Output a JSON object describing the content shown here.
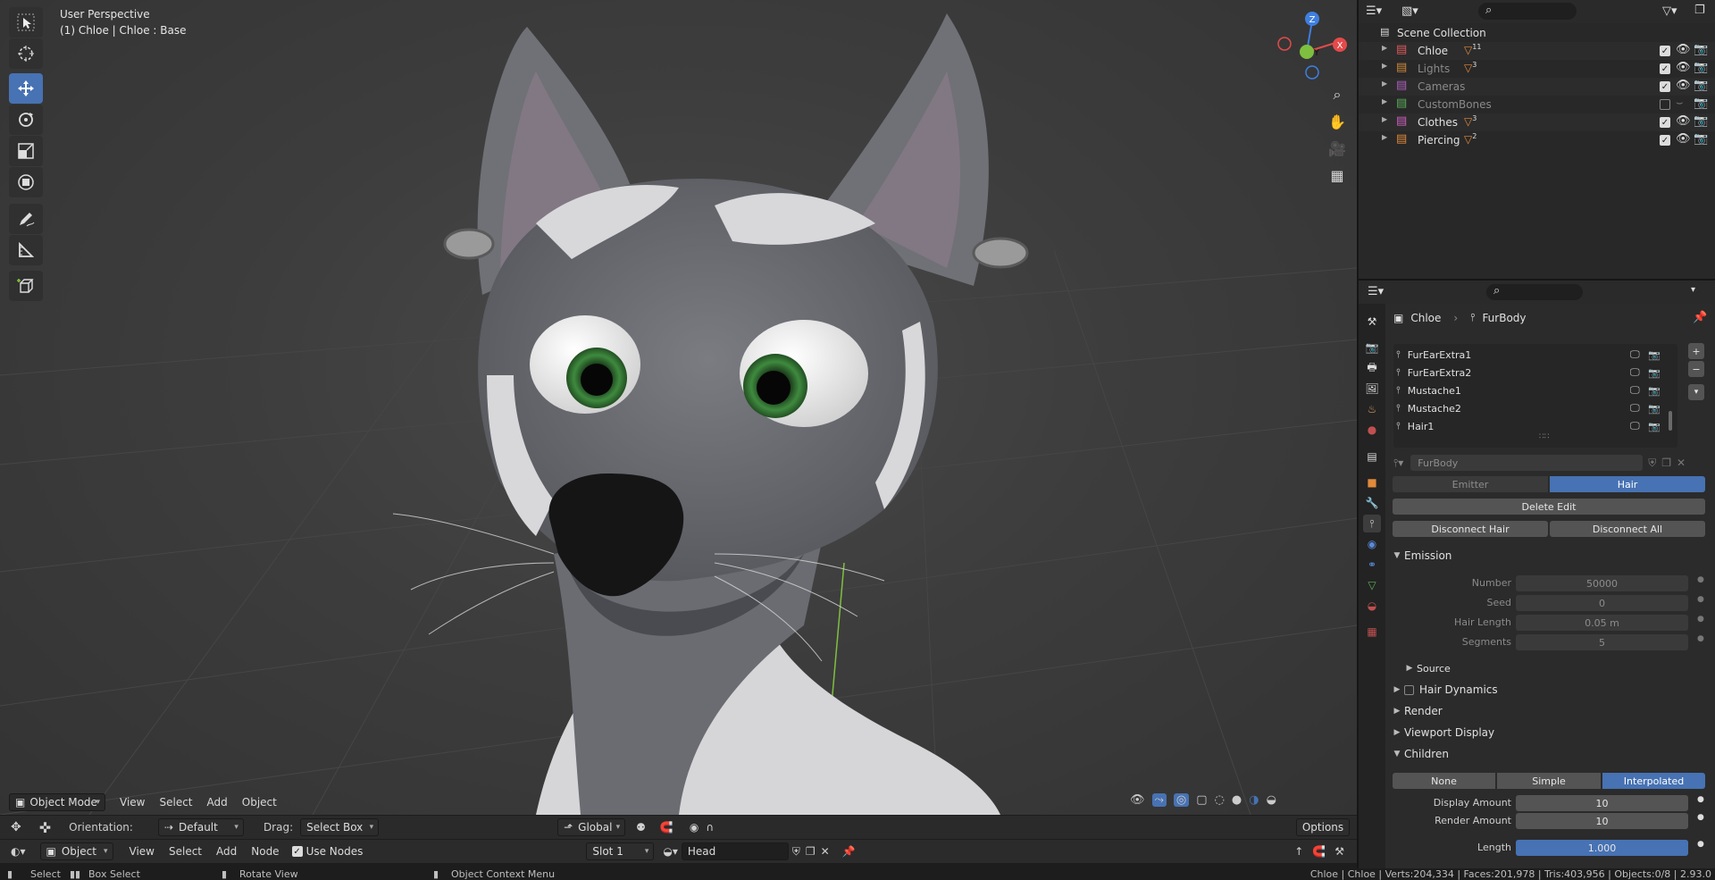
{
  "viewport": {
    "perspective_label": "User Perspective",
    "object_label": "(1) Chloe | Chloe : Base",
    "gizmo": {
      "z": "Z",
      "y": "Y",
      "x": "X"
    },
    "header": {
      "mode": "Object Mode",
      "menu": [
        "View",
        "Select",
        "Add",
        "Object"
      ]
    }
  },
  "tool_settings": {
    "orientation_label": "Orientation:",
    "orientation_value": "Default",
    "drag_label": "Drag:",
    "drag_value": "Select Box",
    "transform_orientation": "Global",
    "options_label": "Options"
  },
  "node_editor_header": {
    "object_type": "Object",
    "menu": [
      "View",
      "Select",
      "Add",
      "Node"
    ],
    "use_nodes_label": "Use Nodes",
    "use_nodes": true,
    "slot": "Slot 1",
    "material": "Head"
  },
  "outliner": {
    "root": "Scene Collection",
    "items": [
      {
        "label": "Chloe",
        "badge": "11",
        "color": "#e05a5a",
        "visible": true,
        "dim": false
      },
      {
        "label": "Lights",
        "badge": "3",
        "color": "#d08a3a",
        "visible": true,
        "dim": true
      },
      {
        "label": "Cameras",
        "badge": "",
        "color": "#b060c0",
        "visible": true,
        "dim": true
      },
      {
        "label": "CustomBones",
        "badge": "",
        "color": "#5ab05a",
        "visible": false,
        "dim": true
      },
      {
        "label": "Clothes",
        "badge": "3",
        "color": "#d060c0",
        "visible": true,
        "dim": false
      },
      {
        "label": "Piercing",
        "badge": "2",
        "color": "#e08a3a",
        "visible": true,
        "dim": false
      }
    ]
  },
  "properties": {
    "breadcrumb": {
      "object": "Chloe",
      "system": "FurBody"
    },
    "particle_systems": [
      "FurEarExtra1",
      "FurEarExtra2",
      "Mustache1",
      "Mustache2",
      "Hair1"
    ],
    "settings_name": "FurBody",
    "type_options": [
      "Emitter",
      "Hair"
    ],
    "type_selected": "Hair",
    "delete_edit": "Delete Edit",
    "disconnect_hair": "Disconnect Hair",
    "disconnect_all": "Disconnect All",
    "emission": {
      "title": "Emission",
      "fields": [
        {
          "label": "Number",
          "value": "50000"
        },
        {
          "label": "Seed",
          "value": "0"
        },
        {
          "label": "Hair Length",
          "value": "0.05 m"
        },
        {
          "label": "Segments",
          "value": "5"
        }
      ],
      "source": "Source"
    },
    "panels": [
      "Hair Dynamics",
      "Render",
      "Viewport Display"
    ],
    "children": {
      "title": "Children",
      "options": [
        "None",
        "Simple",
        "Interpolated"
      ],
      "selected": "Interpolated",
      "display_amount_label": "Display Amount",
      "display_amount": "10",
      "render_amount_label": "Render Amount",
      "render_amount": "10",
      "length_label": "Length",
      "length": "1.000",
      "length_fraction": 1.0
    }
  },
  "status_bar": {
    "select": "Select",
    "box_select": "Box Select",
    "rotate_view": "Rotate View",
    "context_menu": "Object Context Menu",
    "stats": "Chloe | Chloe | Verts:204,334 | Faces:201,978 | Tris:403,956 | Objects:0/8 | 2.93.0"
  },
  "colors": {
    "accent": "#4772b3",
    "gizmo_x": "#e34a4a",
    "gizmo_y": "#7fbf3f",
    "gizmo_z": "#3f7fdf"
  }
}
